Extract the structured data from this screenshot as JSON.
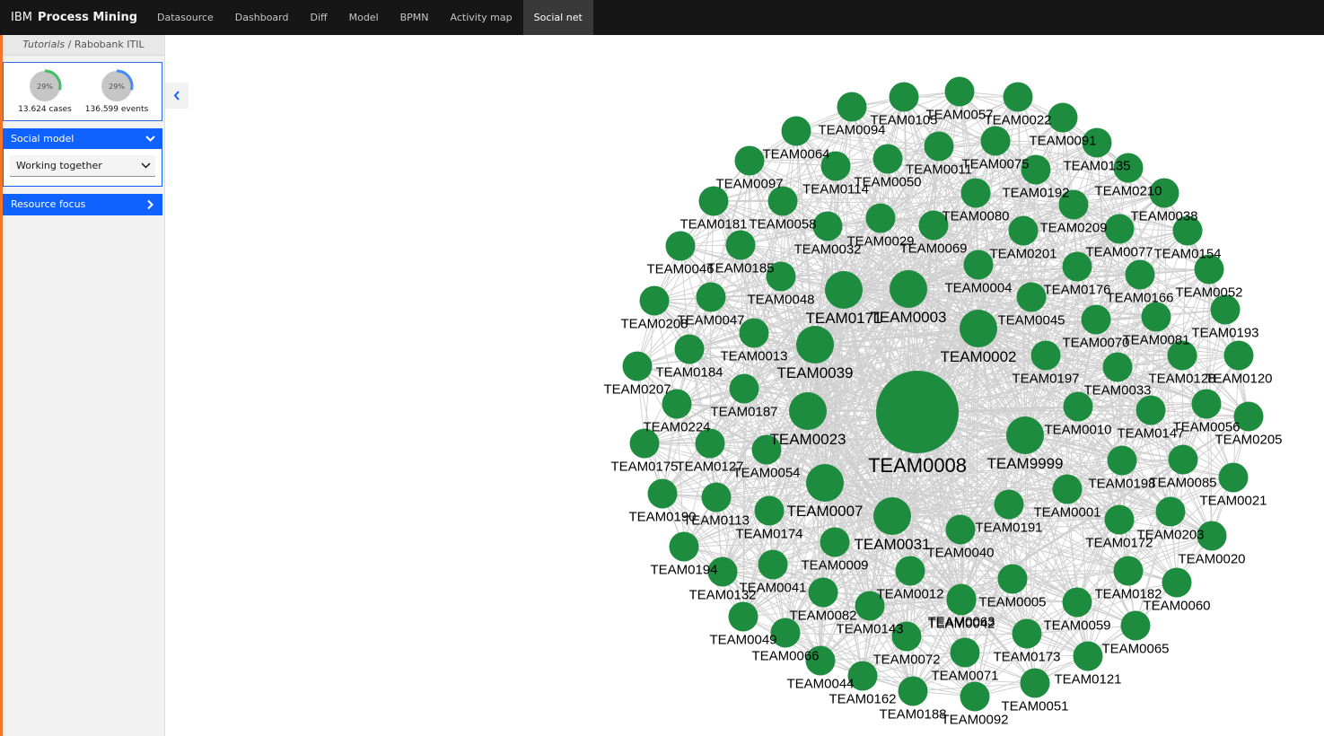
{
  "app": {
    "brand_ibm": "IBM",
    "brand_product": "Process Mining"
  },
  "nav": {
    "tabs": [
      "Datasource",
      "Dashboard",
      "Diff",
      "Model",
      "BPMN",
      "Activity map",
      "Social net"
    ],
    "active": "Social net"
  },
  "breadcrumb": {
    "project": "Tutorials",
    "separator": " / ",
    "process": "Rabobank ITIL"
  },
  "stats": {
    "cases": {
      "percent": "29%",
      "fraction": 0.29,
      "caption": "13.624 cases",
      "color": "#42be65"
    },
    "events": {
      "percent": "29%",
      "fraction": 0.29,
      "caption": "136.599 events",
      "color": "#4589ff"
    }
  },
  "panels": {
    "social_model": {
      "title": "Social model",
      "selected": "Working together"
    },
    "resource_focus": {
      "title": "Resource focus"
    }
  },
  "colors": {
    "node": "#1e8c3e",
    "edge": "#cfcfcf",
    "accent": "#0f62fe",
    "topbar": "#161616"
  },
  "network": {
    "nodes": [
      {
        "label": "TEAM0008",
        "size": "xl"
      },
      {
        "label": "TEAM9999",
        "size": "l"
      },
      {
        "label": "TEAM0002",
        "size": "l"
      },
      {
        "label": "TEAM0003",
        "size": "l"
      },
      {
        "label": "TEAM0171",
        "size": "l"
      },
      {
        "label": "TEAM0039",
        "size": "l"
      },
      {
        "label": "TEAM0023",
        "size": "l"
      },
      {
        "label": "TEAM0007",
        "size": "l"
      },
      {
        "label": "TEAM0031",
        "size": "l"
      },
      {
        "label": "TEAM0040",
        "size": "m"
      },
      {
        "label": "TEAM0191",
        "size": "m"
      },
      {
        "label": "TEAM0001",
        "size": "m"
      },
      {
        "label": "TEAM0010",
        "size": "m"
      },
      {
        "label": "TEAM0197",
        "size": "m"
      },
      {
        "label": "TEAM0045",
        "size": "m"
      },
      {
        "label": "TEAM0004",
        "size": "m"
      },
      {
        "label": "TEAM0069",
        "size": "m"
      },
      {
        "label": "TEAM0029",
        "size": "m"
      },
      {
        "label": "TEAM0032",
        "size": "m"
      },
      {
        "label": "TEAM0048",
        "size": "m"
      },
      {
        "label": "TEAM0013",
        "size": "m"
      },
      {
        "label": "TEAM0187",
        "size": "m"
      },
      {
        "label": "TEAM0054",
        "size": "m"
      },
      {
        "label": "TEAM0174",
        "size": "m"
      },
      {
        "label": "TEAM0009",
        "size": "m"
      },
      {
        "label": "TEAM0012",
        "size": "m"
      },
      {
        "label": "TEAM0063",
        "size": "m"
      },
      {
        "label": "TEAM0005",
        "size": "m"
      },
      {
        "label": "TEAM0172",
        "size": "m"
      },
      {
        "label": "TEAM0198",
        "size": "m"
      },
      {
        "label": "TEAM0147",
        "size": "m"
      },
      {
        "label": "TEAM0033",
        "size": "m"
      },
      {
        "label": "TEAM0070",
        "size": "m"
      },
      {
        "label": "TEAM0176",
        "size": "m"
      },
      {
        "label": "TEAM0201",
        "size": "m"
      },
      {
        "label": "TEAM0080",
        "size": "m"
      },
      {
        "label": "TEAM0050",
        "size": "m"
      },
      {
        "label": "TEAM0114",
        "size": "m"
      },
      {
        "label": "TEAM0058",
        "size": "m"
      },
      {
        "label": "TEAM0185",
        "size": "m"
      },
      {
        "label": "TEAM0047",
        "size": "m"
      },
      {
        "label": "TEAM0184",
        "size": "m"
      },
      {
        "label": "TEAM0224",
        "size": "m"
      },
      {
        "label": "TEAM0127",
        "size": "m"
      },
      {
        "label": "TEAM0113",
        "size": "m"
      },
      {
        "label": "TEAM0041",
        "size": "m"
      },
      {
        "label": "TEAM0082",
        "size": "m"
      },
      {
        "label": "TEAM0143",
        "size": "m"
      },
      {
        "label": "TEAM0042",
        "size": "m"
      },
      {
        "label": "TEAM0059",
        "size": "m"
      },
      {
        "label": "TEAM0182",
        "size": "m"
      },
      {
        "label": "TEAM0203",
        "size": "m"
      },
      {
        "label": "TEAM0085",
        "size": "m"
      },
      {
        "label": "TEAM0056",
        "size": "m"
      },
      {
        "label": "TEAM0128",
        "size": "m"
      },
      {
        "label": "TEAM0081",
        "size": "m"
      },
      {
        "label": "TEAM0166",
        "size": "m"
      },
      {
        "label": "TEAM0077",
        "size": "m"
      },
      {
        "label": "TEAM0209",
        "size": "m"
      },
      {
        "label": "TEAM0192",
        "size": "m"
      },
      {
        "label": "TEAM0075",
        "size": "m"
      },
      {
        "label": "TEAM0011",
        "size": "m"
      },
      {
        "label": "TEAM0094",
        "size": "m"
      },
      {
        "label": "TEAM0105",
        "size": "m"
      },
      {
        "label": "TEAM0057",
        "size": "m"
      },
      {
        "label": "TEAM0022",
        "size": "m"
      },
      {
        "label": "TEAM0091",
        "size": "m"
      },
      {
        "label": "TEAM0135",
        "size": "m"
      },
      {
        "label": "TEAM0210",
        "size": "m"
      },
      {
        "label": "TEAM0038",
        "size": "m"
      },
      {
        "label": "TEAM0154",
        "size": "m"
      },
      {
        "label": "TEAM0052",
        "size": "m"
      },
      {
        "label": "TEAM0193",
        "size": "m"
      },
      {
        "label": "TEAM0120",
        "size": "m"
      },
      {
        "label": "TEAM0205",
        "size": "m"
      },
      {
        "label": "TEAM0021",
        "size": "m"
      },
      {
        "label": "TEAM0020",
        "size": "m"
      },
      {
        "label": "TEAM0060",
        "size": "m"
      },
      {
        "label": "TEAM0065",
        "size": "m"
      },
      {
        "label": "TEAM0121",
        "size": "m"
      },
      {
        "label": "TEAM0051",
        "size": "m"
      },
      {
        "label": "TEAM0092",
        "size": "m"
      },
      {
        "label": "TEAM0188",
        "size": "m"
      },
      {
        "label": "TEAM0162",
        "size": "m"
      },
      {
        "label": "TEAM0044",
        "size": "m"
      },
      {
        "label": "TEAM0066",
        "size": "m"
      },
      {
        "label": "TEAM0049",
        "size": "m"
      },
      {
        "label": "TEAM0132",
        "size": "m"
      },
      {
        "label": "TEAM0194",
        "size": "m"
      },
      {
        "label": "TEAM0190",
        "size": "m"
      },
      {
        "label": "TEAM0175",
        "size": "m"
      },
      {
        "label": "TEAM0207",
        "size": "m"
      },
      {
        "label": "TEAM0208",
        "size": "m"
      },
      {
        "label": "TEAM0046",
        "size": "m"
      },
      {
        "label": "TEAM0181",
        "size": "m"
      },
      {
        "label": "TEAM0097",
        "size": "m"
      },
      {
        "label": "TEAM0064",
        "size": "m"
      },
      {
        "label": "TEAM0072",
        "size": "m"
      },
      {
        "label": "TEAM0071",
        "size": "m"
      },
      {
        "label": "TEAM0173",
        "size": "m"
      }
    ]
  }
}
